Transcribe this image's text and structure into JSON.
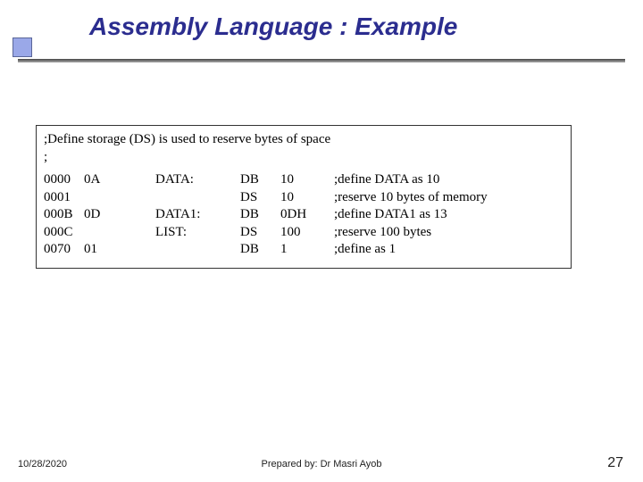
{
  "title": "Assembly Language : Example",
  "comment_line1": ";Define storage (DS) is used to reserve bytes of space",
  "comment_line2": ";",
  "rows": [
    {
      "addr": "0000",
      "byte": "0A",
      "label": "DATA:",
      "op": "DB",
      "val": "10",
      "cmt": ";define DATA as 10"
    },
    {
      "addr": "0001",
      "byte": "",
      "label": "",
      "op": "DS",
      "val": "10",
      "cmt": ";reserve 10 bytes of memory"
    },
    {
      "addr": "000B",
      "byte": "0D",
      "label": "DATA1:",
      "op": "DB",
      "val": "0DH",
      "cmt": ";define DATA1 as 13"
    },
    {
      "addr": "000C",
      "byte": "",
      "label": "LIST:",
      "op": "DS",
      "val": "100",
      "cmt": ";reserve 100 bytes"
    },
    {
      "addr": "0070",
      "byte": "01",
      "label": "",
      "op": "DB",
      "val": "1",
      "cmt": ";define as 1"
    }
  ],
  "footer": {
    "date": "10/28/2020",
    "author": "Prepared by: Dr Masri Ayob",
    "page": "27"
  }
}
